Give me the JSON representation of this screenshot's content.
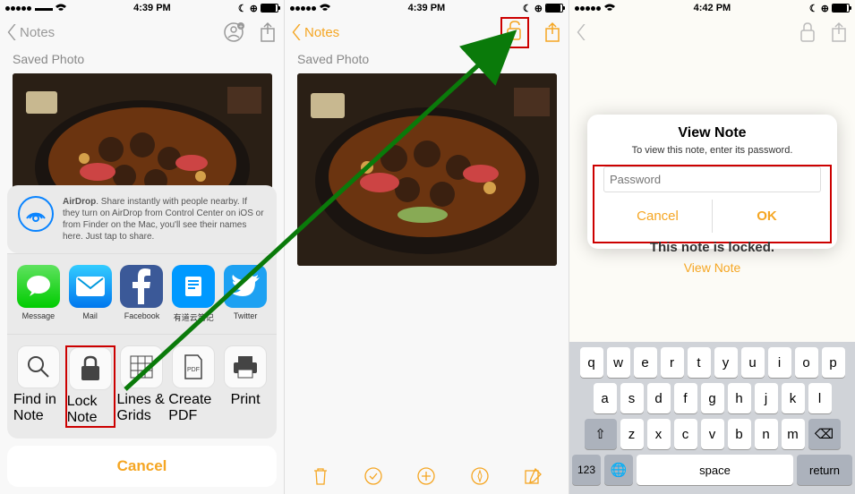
{
  "status": {
    "time1": "4:39 PM",
    "time2": "4:39 PM",
    "time3": "4:42 PM"
  },
  "nav": {
    "back": "Notes"
  },
  "note": {
    "title": "Saved Photo"
  },
  "airdrop": {
    "label": "AirDrop",
    "text": ". Share instantly with people nearby. If they turn on AirDrop from Control Center on iOS or from Finder on the Mac, you'll see their names here. Just tap to share."
  },
  "apps": {
    "message": "Message",
    "mail": "Mail",
    "facebook": "Facebook",
    "youdao": "有道云笔记",
    "twitter": "Twitter"
  },
  "actions": {
    "find": "Find in Note",
    "lock": "Lock Note",
    "lines": "Lines & Grids",
    "pdf": "Create PDF",
    "print": "Print"
  },
  "cancel": "Cancel",
  "dialog": {
    "title": "View Note",
    "subtitle": "To view this note, enter its password.",
    "placeholder": "Password",
    "cancel": "Cancel",
    "ok": "OK"
  },
  "locked": {
    "text": "This note is locked.",
    "link": "View Note"
  },
  "keyboard": {
    "r1": [
      "q",
      "w",
      "e",
      "r",
      "t",
      "y",
      "u",
      "i",
      "o",
      "p"
    ],
    "r2": [
      "a",
      "s",
      "d",
      "f",
      "g",
      "h",
      "j",
      "k",
      "l"
    ],
    "r3": [
      "z",
      "x",
      "c",
      "v",
      "b",
      "n",
      "m"
    ],
    "num": "123",
    "space": "space",
    "return": "return"
  }
}
